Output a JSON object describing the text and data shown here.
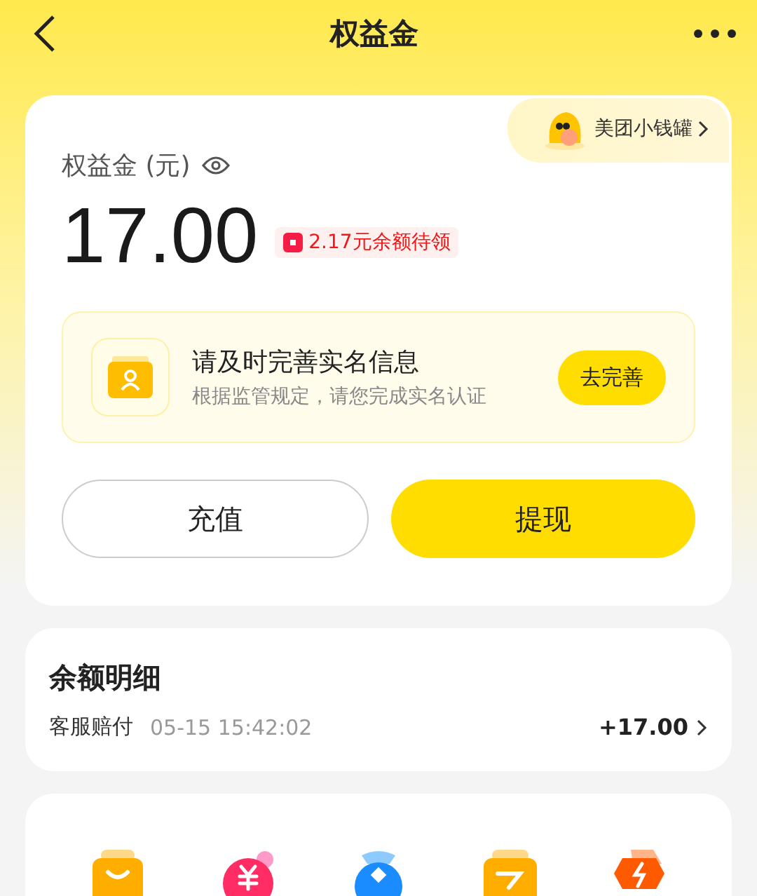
{
  "header": {
    "title": "权益金"
  },
  "balance_card": {
    "piggy_bank_link": "美团小钱罐",
    "label": "权益金 (元)",
    "amount": "17.00",
    "pending_badge": "2.17元余额待领",
    "notice": {
      "title": "请及时完善实名信息",
      "subtitle": "根据监管规定，请您完成实名认证",
      "button": "去完善"
    },
    "buttons": [
      {
        "label": "充值",
        "kind": "outline"
      },
      {
        "label": "提现",
        "kind": "primary"
      }
    ]
  },
  "details": {
    "title": "余额明细",
    "rows": [
      {
        "name": "客服赔付",
        "time": "05-15 15:42:02",
        "amount": "+17.00"
      }
    ]
  },
  "services": [
    {
      "kind": "bag"
    },
    {
      "kind": "yuan"
    },
    {
      "kind": "pouch"
    },
    {
      "kind": "wallet"
    },
    {
      "kind": "bolt"
    }
  ]
}
